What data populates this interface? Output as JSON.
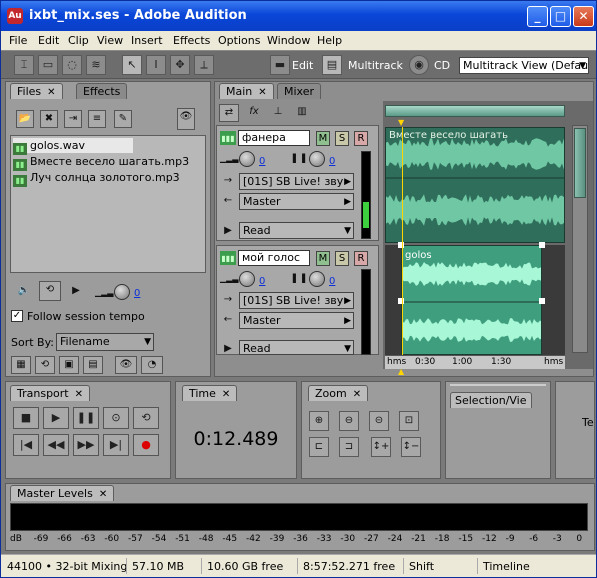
{
  "window": {
    "title": "ixbt_mix.ses - Adobe Audition",
    "app_icon": "audition-icon",
    "controls": [
      "minimize-icon",
      "maximize-icon",
      "close-icon"
    ]
  },
  "menu": [
    "File",
    "Edit",
    "Clip",
    "View",
    "Insert",
    "Effects",
    "Options",
    "Window",
    "Help"
  ],
  "toolbar": {
    "edit_label": "Edit",
    "multitrack_label": "Multitrack",
    "cd_label": "CD",
    "workspace_value": "Multitrack View (Defaul"
  },
  "files_panel": {
    "tab_files": "Files",
    "tab_effects": "Effects",
    "files": [
      "golos.wav",
      "Вместе весело шагать.mp3",
      "Луч солнца золотого.mp3"
    ],
    "volume_value": "0",
    "follow_tempo_label": "Follow session tempo",
    "follow_tempo_checked": true,
    "sort_by_label": "Sort By:",
    "sort_by_value": "Filename"
  },
  "tracks_panel": {
    "tab_main": "Main",
    "tab_mixer": "Mixer",
    "tracks": [
      {
        "name": "фанера",
        "volume": "0",
        "pan": "0",
        "input": "[01S] SB Live! зву",
        "output": "Master",
        "automation": "Read",
        "clip_label": "Вместе весело шагать"
      },
      {
        "name": "мой голос",
        "volume": "0",
        "pan": "0",
        "input": "[01S] SB Live! зву",
        "output": "Master",
        "automation": "Read",
        "clip_label": "golos"
      }
    ],
    "ruler": [
      "hms",
      "0:30",
      "1:00",
      "1:30",
      "hms"
    ],
    "buttons": {
      "mute": "M",
      "solo": "S",
      "record": "R"
    }
  },
  "transport": {
    "tab": "Transport"
  },
  "time": {
    "tab": "Time",
    "value": "0:12.489"
  },
  "zoom": {
    "tab": "Zoom"
  },
  "selection": {
    "tab": "Selection/Vie",
    "extra_tab_text": "Te"
  },
  "master_levels": {
    "tab": "Master Levels",
    "scale": [
      "dB",
      "-69",
      "-66",
      "-63",
      "-60",
      "-57",
      "-54",
      "-51",
      "-48",
      "-45",
      "-42",
      "-39",
      "-36",
      "-33",
      "-30",
      "-27",
      "-24",
      "-21",
      "-18",
      "-15",
      "-12",
      "-9",
      "-6",
      "-3",
      "0"
    ]
  },
  "status": {
    "format": "44100 • 32-bit Mixing",
    "mem": "57.10 MB",
    "disk": "10.60 GB free",
    "time_free": "8:57:52.271 free",
    "key": "Shift",
    "mode": "Timeline"
  },
  "colors": {
    "title_blue": "#0a46d8",
    "wave_green": "#2e8f6f",
    "wave_bright": "#7fe8c0",
    "panel_gray": "#9c9c9c",
    "link_blue": "#0b2fd8"
  }
}
